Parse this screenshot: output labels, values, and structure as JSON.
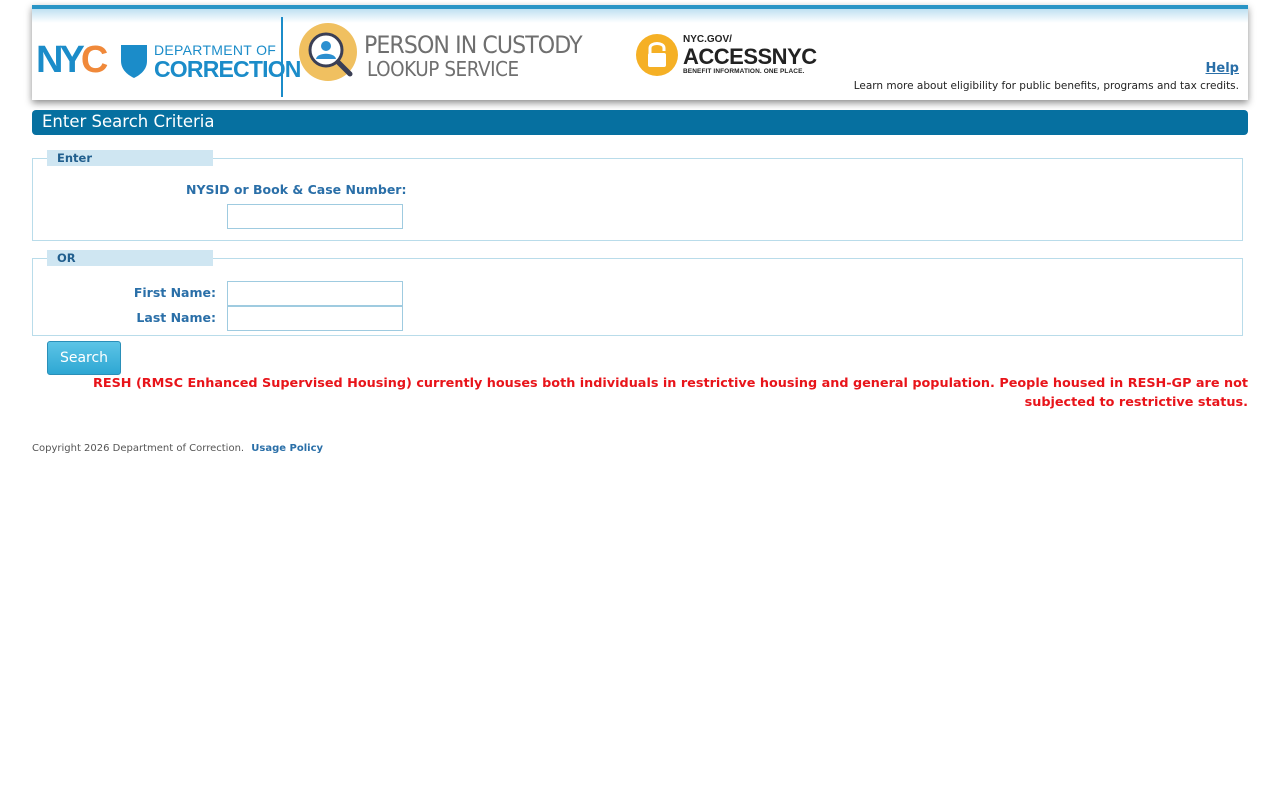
{
  "header": {
    "nyc_logo": {
      "n": "N",
      "y": "Y",
      "c": "C"
    },
    "doc_logo": {
      "line1": "DEPARTMENT OF",
      "line2": "CORRECTION"
    },
    "service_logo": {
      "line1": "PERSON IN CUSTODY",
      "line2": "LOOKUP SERVICE"
    },
    "access_logo": {
      "line1": "NYC.GOV/",
      "line2": "ACCESSNYC",
      "line3": "BENEFIT INFORMATION. ONE PLACE."
    },
    "help_label": "Help",
    "help_description": "Learn more about eligibility for public benefits, programs and tax credits."
  },
  "title": "Enter Search Criteria",
  "enter_section": {
    "legend": "Enter",
    "nysid_label": "NYSID or Book & Case Number:",
    "nysid_value": ""
  },
  "or_section": {
    "legend": "OR",
    "first_name_label": "First Name:",
    "first_name_value": "",
    "last_name_label": "Last Name:",
    "last_name_value": ""
  },
  "search_button": "Search",
  "notice": "RESH (RMSC Enhanced Supervised Housing) currently houses both individuals in restrictive housing and general population. People housed in RESH-GP are not subjected to restrictive status.",
  "footer": {
    "copyright": "Copyright 2026 Department of Correction.",
    "usage_policy": "Usage Policy"
  },
  "colors": {
    "brand_blue": "#1b8cc9",
    "nyc_orange": "#f0893a",
    "title_bar": "#0670a0",
    "label_blue": "#2a6fa8",
    "notice_red": "#e8141a",
    "service_gold": "#f0c060",
    "access_gold": "#f5b025"
  },
  "icons": {
    "doc_shield": "shield-icon",
    "service": "person-magnifier-icon",
    "access": "padlock-icon"
  }
}
